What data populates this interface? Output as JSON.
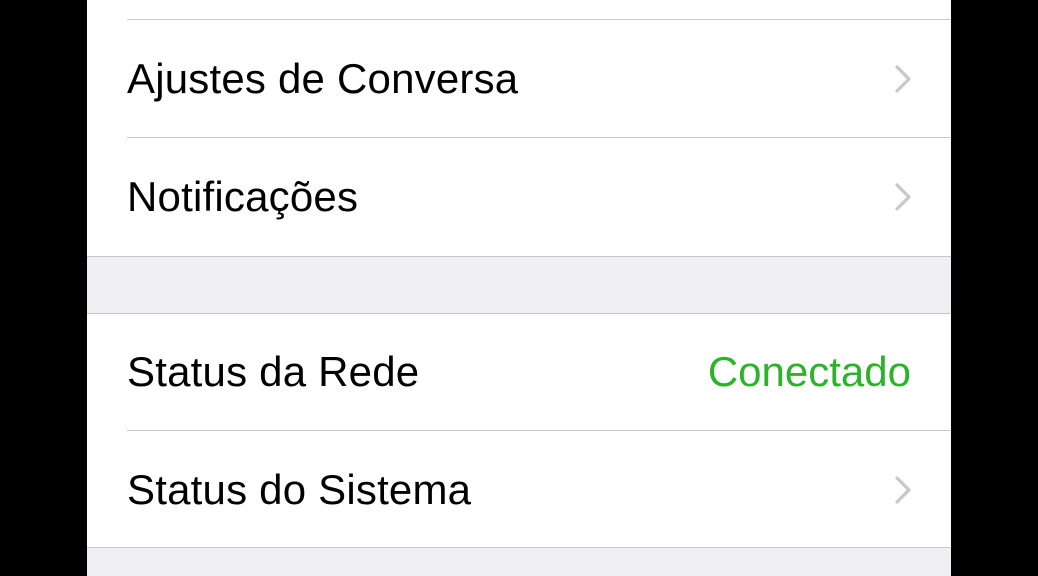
{
  "settings": {
    "section1": {
      "items": [
        {
          "label": "Ajustes de Conversa"
        },
        {
          "label": "Notificações"
        }
      ]
    },
    "section2": {
      "network_status": {
        "label": "Status da Rede",
        "value": "Conectado",
        "value_color": "#2db329"
      },
      "system_status": {
        "label": "Status do Sistema"
      }
    }
  },
  "icons": {
    "disclosure": "chevron-right-icon"
  },
  "colors": {
    "background": "#efeff4",
    "cell": "#ffffff",
    "separator": "#c8c7cc",
    "chevron": "#c7c7cc",
    "status_ok": "#2db329"
  }
}
